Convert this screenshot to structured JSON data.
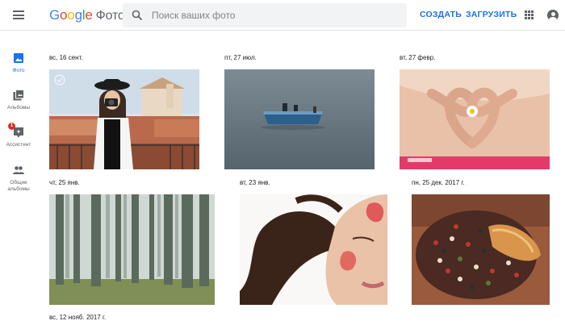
{
  "header": {
    "logo_parts": [
      "G",
      "o",
      "o",
      "g",
      "l",
      "e"
    ],
    "product": "Фото",
    "search_placeholder": "Поиск ваших фото",
    "create_label": "СОЗДАТЬ",
    "upload_label": "ЗАГРУЗИТЬ",
    "icons": [
      "menu-icon",
      "search-icon",
      "apps-icon",
      "account-icon"
    ]
  },
  "sidebar": {
    "items": [
      {
        "label": "Фото",
        "icon": "photo-icon",
        "active": true
      },
      {
        "label": "Альбомы",
        "icon": "albums-icon",
        "active": false
      },
      {
        "label": "Ассистент",
        "icon": "assistant-icon",
        "active": false,
        "badge": "1"
      },
      {
        "label": "Общие альбомы",
        "icon": "shared-albums-icon",
        "active": false
      }
    ]
  },
  "groups": [
    {
      "date": "вс, 16 сент.",
      "photo": "woman-with-camera"
    },
    {
      "date": "пт, 27 июл.",
      "photo": "boat-on-water"
    },
    {
      "date": "вт, 27 февр.",
      "photo": "hands-heart-belly"
    },
    {
      "date": "чт, 25 янв.",
      "photo": "foggy-forest"
    },
    {
      "date": "вт, 23 янв.",
      "photo": "face-with-petals"
    },
    {
      "date": "пн, 25 дек. 2017 г.",
      "photo": "peppercorns"
    },
    {
      "date": "вс, 12 нояб. 2017 г.",
      "photo": ""
    }
  ],
  "colors": {
    "accent": "#1a73e8",
    "badge": "#d93025",
    "search_bg": "#f1f3f4"
  }
}
